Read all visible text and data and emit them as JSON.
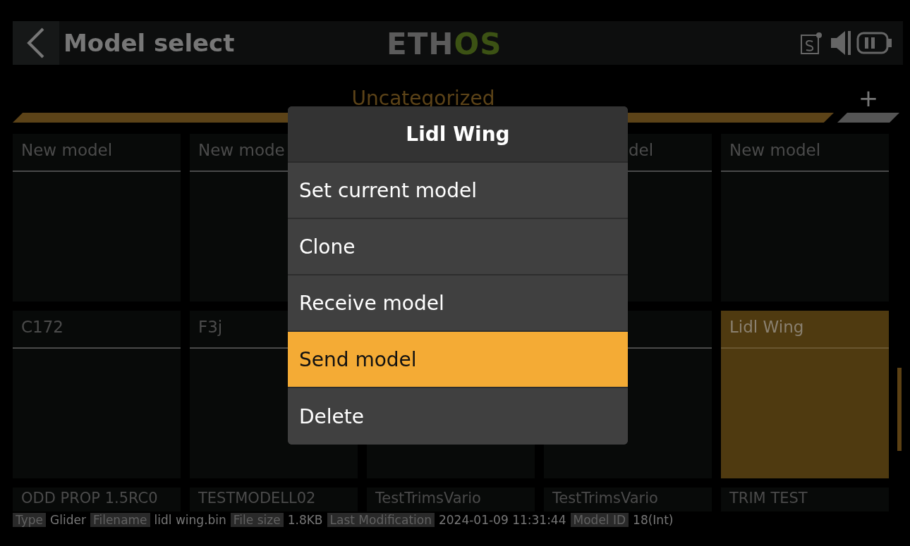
{
  "header": {
    "title": "Model select",
    "logo": [
      {
        "text": "ETH",
        "kind": "plain"
      },
      {
        "text": "OS",
        "kind": "accent"
      }
    ]
  },
  "category": {
    "label": "Uncategorized",
    "selected": true,
    "add": "+"
  },
  "rows": [
    [
      {
        "title": "New model",
        "selected": false
      },
      {
        "title": "New mode",
        "selected": false
      },
      {},
      {
        "title": "del",
        "selected": false
      },
      {
        "title": "New model",
        "selected": false
      }
    ],
    [
      {
        "title": "C172",
        "selected": false
      },
      {
        "title": "F3j",
        "selected": false
      },
      {},
      {
        "selected": false
      },
      {
        "title": "Lidl Wing",
        "selected": true
      }
    ],
    [
      {
        "title": "ODD PROP 1.5RC0",
        "selected": false
      },
      {
        "title": "TESTMODELL02",
        "selected": false
      },
      {
        "title": "TestTrimsVario",
        "selected": false
      },
      {
        "title": "TestTrimsVario",
        "selected": false
      },
      {
        "title": "TRIM TEST",
        "selected": false
      }
    ]
  ],
  "popup": {
    "title": "Lidl Wing",
    "items": [
      {
        "label": "Set current model",
        "selected": false
      },
      {
        "label": "Clone",
        "selected": false
      },
      {
        "label": "Receive model",
        "selected": false
      },
      {
        "label": "Send model",
        "selected": true
      },
      {
        "label": "Delete",
        "selected": false
      }
    ]
  },
  "status_bar": [
    {
      "label": "Type",
      "value": "Glider"
    },
    {
      "label": "Filename",
      "value": "lidl wing.bin"
    },
    {
      "label": "File size",
      "value": "1.8KB"
    },
    {
      "label": "Last Modification",
      "value": "2024-01-09 11:31:44"
    },
    {
      "label": "Model ID",
      "value": "18(Int)"
    }
  ]
}
